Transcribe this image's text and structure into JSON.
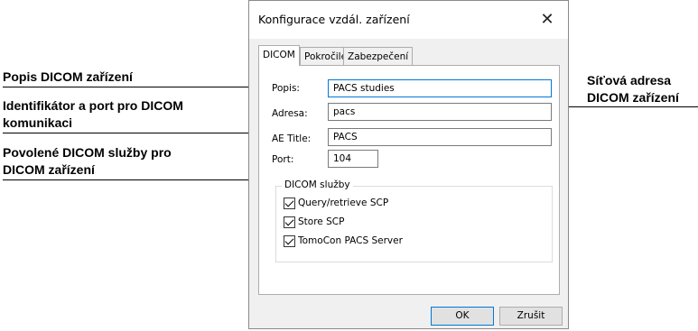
{
  "callouts": {
    "popis": "Popis DICOM zařízení",
    "ident_line1": "Identifikátor a port pro DICOM",
    "ident_line2": "komunikaci",
    "sluzby_line1": "Povolené DICOM služby pro",
    "sluzby_line2": "DICOM zařízení",
    "adresa_line1": "Síťová adresa",
    "adresa_line2": "DICOM zařízení"
  },
  "dialog": {
    "title": "Konfigurace vzdál. zařízení",
    "close_glyph": "✕",
    "tabs": [
      {
        "label": "DICOM",
        "active": true
      },
      {
        "label": "Pokročilé",
        "active": false
      },
      {
        "label": "Zabezpečení",
        "active": false
      }
    ],
    "fields": {
      "popis": {
        "label": "Popis:",
        "value": "PACS studies"
      },
      "adresa": {
        "label": "Adresa:",
        "value": "pacs"
      },
      "ae_title": {
        "label": "AE Title:",
        "value": "PACS"
      },
      "port": {
        "label": "Port:",
        "value": "104"
      }
    },
    "services": {
      "title": "DICOM služby",
      "items": [
        {
          "label": "Query/retrieve SCP",
          "checked": true
        },
        {
          "label": "Store SCP",
          "checked": true
        },
        {
          "label": "TomoCon PACS Server",
          "checked": true
        }
      ]
    },
    "buttons": {
      "ok": "OK",
      "cancel": "Zrušit"
    }
  }
}
